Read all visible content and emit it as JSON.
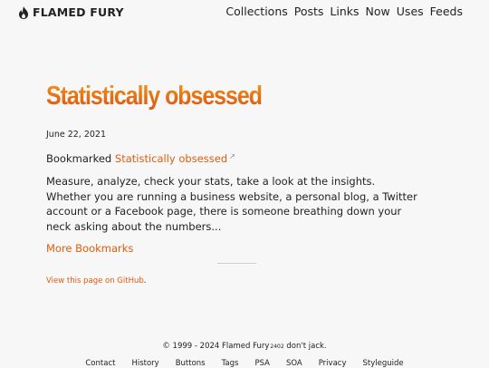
{
  "header": {
    "brand": "FLAMED FURY",
    "brand_icon": "flame-icon",
    "nav": [
      {
        "label": "Collections"
      },
      {
        "label": "Posts"
      },
      {
        "label": "Links"
      },
      {
        "label": "Now"
      },
      {
        "label": "Uses"
      },
      {
        "label": "Feeds"
      }
    ]
  },
  "post": {
    "title": "Statistically obsessed",
    "date": "June 22, 2021",
    "bookmarked_prefix": "Bookmarked",
    "bookmarked_link": "Statistically obsessed",
    "external_icon": "↗",
    "summary": "Measure, analyze, check your stats, take a look at the insights. Whether you are running a business website, a personal blog, a Twitter account or a Facebook page, there is someone breathing down your neck asking about the numbers...",
    "more_link": "More Bookmarks",
    "github_link": "View this page on GitHub",
    "github_suffix": "."
  },
  "footer": {
    "copyright": "© 1999 - 2024",
    "site_link": "Flamed Fury",
    "version": "2402",
    "tagline": "don't jack.",
    "links": [
      {
        "label": "Contact"
      },
      {
        "label": "History"
      },
      {
        "label": "Buttons"
      },
      {
        "label": "Tags"
      },
      {
        "label": "PSA"
      },
      {
        "label": "SOA"
      },
      {
        "label": "Privacy"
      },
      {
        "label": "Styleguide"
      }
    ]
  },
  "colors": {
    "accent": "#e35b0b",
    "title_gradient_top": "#f6a11c",
    "title_gradient_bottom": "#d9531a",
    "background": "#f7f7f7"
  }
}
